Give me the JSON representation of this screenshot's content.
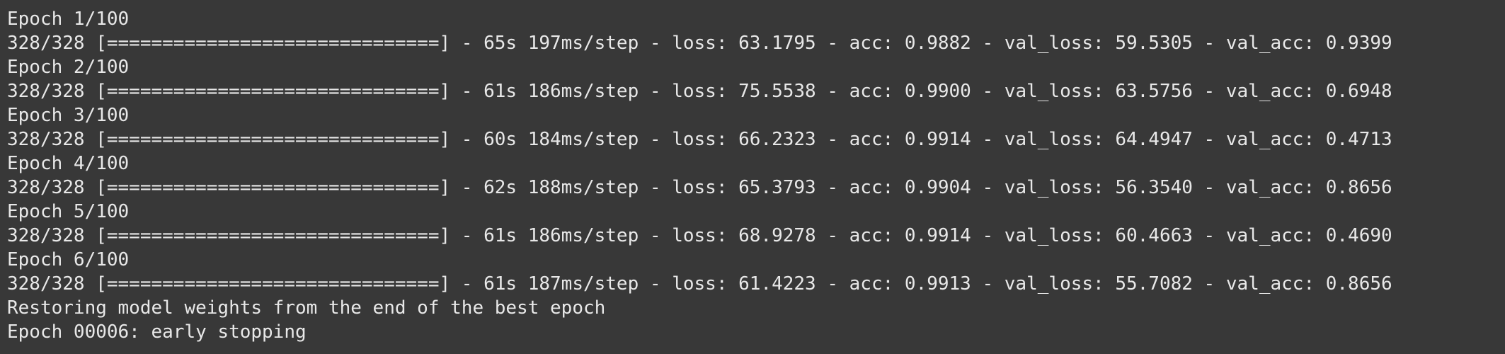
{
  "output": {
    "lines": [
      "Epoch 1/100",
      "328/328 [==============================] - 65s 197ms/step - loss: 63.1795 - acc: 0.9882 - val_loss: 59.5305 - val_acc: 0.9399",
      "Epoch 2/100",
      "328/328 [==============================] - 61s 186ms/step - loss: 75.5538 - acc: 0.9900 - val_loss: 63.5756 - val_acc: 0.6948",
      "Epoch 3/100",
      "328/328 [==============================] - 60s 184ms/step - loss: 66.2323 - acc: 0.9914 - val_loss: 64.4947 - val_acc: 0.4713",
      "Epoch 4/100",
      "328/328 [==============================] - 62s 188ms/step - loss: 65.3793 - acc: 0.9904 - val_loss: 56.3540 - val_acc: 0.8656",
      "Epoch 5/100",
      "328/328 [==============================] - 61s 186ms/step - loss: 68.9278 - acc: 0.9914 - val_loss: 60.4663 - val_acc: 0.4690",
      "Epoch 6/100",
      "328/328 [==============================] - 61s 187ms/step - loss: 61.4223 - acc: 0.9913 - val_loss: 55.7082 - val_acc: 0.8656",
      "Restoring model weights from the end of the best epoch",
      "Epoch 00006: early stopping"
    ]
  },
  "colors": {
    "background": "#383838",
    "text": "#e8e8e8"
  }
}
